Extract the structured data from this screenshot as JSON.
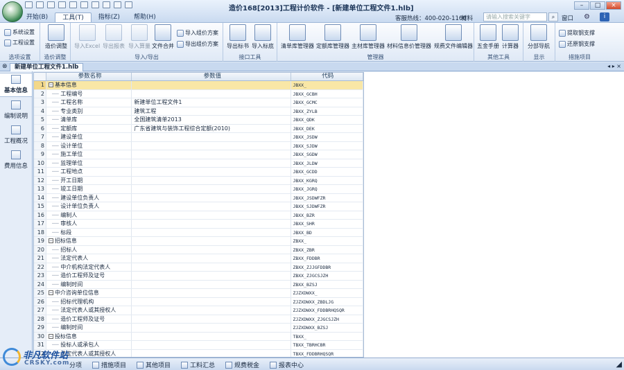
{
  "app": {
    "title": "造价168[2013]工程计价软件 - [新建单位工程文件1.hlb]",
    "menu_tabs": [
      "开始(B)",
      "工具(T)",
      "指标(Z)",
      "帮助(H)"
    ],
    "active_tab": 1,
    "hotline": "客服热线：400-020-1166",
    "material_label": "材料",
    "search_placeholder": "请输入搜索关键字",
    "window_menu": "窗口",
    "info_label": "i"
  },
  "ribbon": {
    "groups": [
      {
        "label": "选项设置",
        "items": [
          "系统设置",
          "工程设置"
        ]
      },
      {
        "label": "造价调整",
        "items": [
          "造价调整"
        ]
      },
      {
        "label": "导入/导出",
        "items": [
          "导入Excel",
          "导出报表",
          "导入算量",
          "文件合并",
          "导入组价方案",
          "导出组价方案"
        ]
      },
      {
        "label": "接口工具",
        "items": [
          "导出标书",
          "导入标底"
        ]
      },
      {
        "label": "管理器",
        "items": [
          "清单库管理器",
          "定额库管理器",
          "主材库管理器",
          "材料信息价管理器",
          "规费文件编辑器"
        ]
      },
      {
        "label": "其他工具",
        "items": [
          "五金手册",
          "计算器"
        ]
      },
      {
        "label": "显示",
        "items": [
          "分部导航"
        ]
      },
      {
        "label": "措施项目",
        "items": [
          "提取钢支撑",
          "还原钢支撑"
        ]
      }
    ]
  },
  "doc_tab": "新建单位工程文件1.hlb",
  "doc_nav": "◂ ▸ ×",
  "sidebar": [
    "基本信息",
    "编制说明",
    "工程概况",
    "费用信息"
  ],
  "table": {
    "headers": [
      "参数名称",
      "参数值",
      "代码"
    ],
    "rows": [
      [
        "1",
        "基本信息",
        "",
        "JBXX_"
      ],
      [
        "2",
        "工程编号",
        "",
        "JBXX_GCBH"
      ],
      [
        "3",
        "工程名称",
        "新建单位工程文件1",
        "JBXX_GCMC"
      ],
      [
        "4",
        "专业类别",
        "建筑工程",
        "JBXX_ZYLB"
      ],
      [
        "5",
        "清单库",
        "全国建筑清单2013",
        "JBXX_QDK"
      ],
      [
        "6",
        "定额库",
        "广东省建筑与装饰工程综合定额(2010)",
        "JBXX_DEK"
      ],
      [
        "7",
        "建设单位",
        "",
        "JBXX_JSDW"
      ],
      [
        "8",
        "设计单位",
        "",
        "JBXX_SJDW"
      ],
      [
        "9",
        "施工单位",
        "",
        "JBXX_SGDW"
      ],
      [
        "10",
        "监理单位",
        "",
        "JBXX_JLDW"
      ],
      [
        "11",
        "工程地点",
        "",
        "JBXX_GCDD"
      ],
      [
        "12",
        "开工日期",
        "",
        "JBXX_KGRQ"
      ],
      [
        "13",
        "竣工日期",
        "",
        "JBXX_JGRQ"
      ],
      [
        "14",
        "建设单位负责人",
        "",
        "JBXX_JSDWFZR"
      ],
      [
        "15",
        "设计单位负责人",
        "",
        "JBXX_SJDWFZR"
      ],
      [
        "16",
        "编制人",
        "",
        "JBXX_BZR"
      ],
      [
        "17",
        "审核人",
        "",
        "JBXX_SHR"
      ],
      [
        "18",
        "标段",
        "",
        "JBXX_BD"
      ],
      [
        "19",
        "招标信息",
        "",
        "ZBXX_"
      ],
      [
        "20",
        "招标人",
        "",
        "ZBXX_ZBR"
      ],
      [
        "21",
        "法定代表人",
        "",
        "ZBXX_FDDBR"
      ],
      [
        "22",
        "中介机构法定代表人",
        "",
        "ZBXX_ZJJGFDDBR"
      ],
      [
        "23",
        "造价工程师及证号",
        "",
        "ZBXX_ZJGCSJZH"
      ],
      [
        "24",
        "编制时间",
        "",
        "ZBXX_BZSJ"
      ],
      [
        "25",
        "中介咨询单位信息",
        "",
        "ZJZXDWXX_"
      ],
      [
        "26",
        "招标代理机构",
        "",
        "ZJZXDWXX_ZBDLJG"
      ],
      [
        "27",
        "法定代表人或其授权人",
        "",
        "ZJZXDWXX_FDDBRHQSQR"
      ],
      [
        "28",
        "造价工程师及证号",
        "",
        "ZJZXDWXX_ZJGCSJZH"
      ],
      [
        "29",
        "编制时间",
        "",
        "ZJZXDWXX_BZSJ"
      ],
      [
        "30",
        "投标信息",
        "",
        "TBXX_"
      ],
      [
        "31",
        "投标人或承包人",
        "",
        "TBXX_TBRHCBR"
      ],
      [
        "32",
        "法定代表人或其授权人",
        "",
        "TBXX_FDDBRHQSQR"
      ]
    ],
    "groups": [
      "1",
      "19",
      "25",
      "30"
    ],
    "selected": "1"
  },
  "bottom_tabs": [
    "分项",
    "措施项目",
    "其他项目",
    "工料汇总",
    "规费税金",
    "报表中心"
  ],
  "watermark": {
    "name": "非凡软件站",
    "domain": "CRSKY.com"
  }
}
